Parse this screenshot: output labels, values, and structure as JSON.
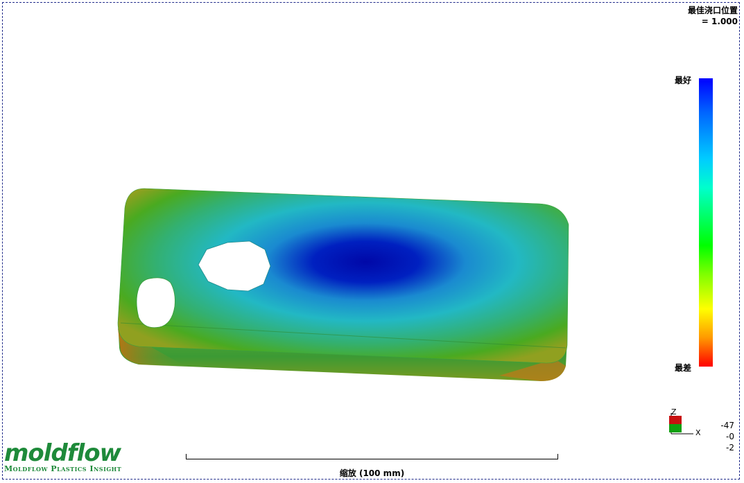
{
  "result": {
    "title": "最佳浇口位置",
    "value": "= 1.000"
  },
  "scale": {
    "top_label": "最好",
    "bottom_label": "最差",
    "colors": [
      "#0000ff",
      "#00ccff",
      "#00ff00",
      "#ffff00",
      "#ff0000"
    ]
  },
  "axes": {
    "z_label": "Z",
    "x_label": "X",
    "readout": [
      "-47",
      "-0",
      "-2"
    ]
  },
  "ruler": {
    "label": "缩放 (100 mm)"
  },
  "logo": {
    "word": "moldflow",
    "subtitle": "Moldflow Plastics Insight",
    "color": "#1e8a3a"
  }
}
